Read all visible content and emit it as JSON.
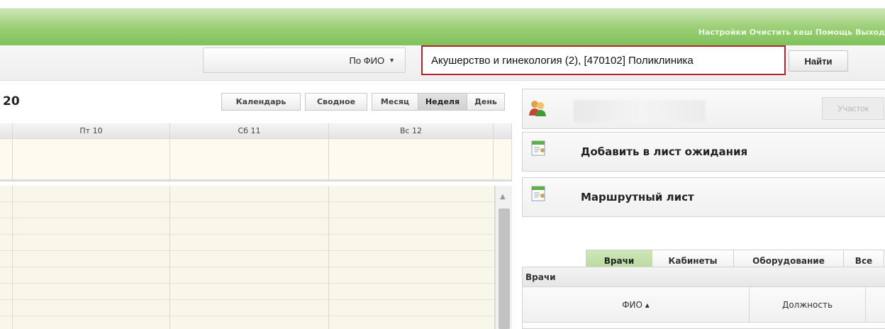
{
  "header": {
    "links": [
      "Настройки",
      "Очистить кеш",
      "Помощь",
      "Выход"
    ]
  },
  "search": {
    "type_label": "По ФИО",
    "value": "Акушерство и гинекология (2), [470102] Поликлиника",
    "find_label": "Найти"
  },
  "calendar": {
    "year_fragment": "20",
    "view_tabs": [
      "Календарь",
      "Сводное",
      "Месяц",
      "Неделя",
      "День"
    ],
    "active_view": "Неделя",
    "days": [
      "Пт 10",
      "Сб 11",
      "Вс 12"
    ]
  },
  "patient": {
    "district_label": "Участок"
  },
  "actions": {
    "waitlist": "Добавить в лист ожидания",
    "route": "Маршрутный лист"
  },
  "resources": {
    "tabs": [
      "Врачи",
      "Кабинеты",
      "Оборудование",
      "Все"
    ],
    "active_tab": "Врачи",
    "section_title": "Врачи",
    "columns": [
      "ФИО ▴",
      "Должность"
    ]
  },
  "colors": {
    "header_green": "#8cc866",
    "search_border": "#b1252c",
    "active_tab_green": "#bcdca2"
  }
}
